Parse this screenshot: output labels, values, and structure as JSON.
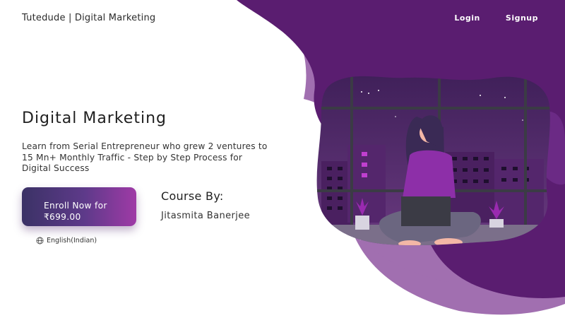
{
  "header": {
    "brand": "Tutedude | Digital Marketing",
    "nav": {
      "login": "Login",
      "signup": "Signup"
    }
  },
  "hero": {
    "title": "Digital Marketing",
    "description": "Learn from Serial Entrepreneur who grew 2 ventures to 15 Mn+ Monthly Traffic - Step by Step Process for Digital Success",
    "enroll": {
      "line1": "Enroll Now for",
      "line2": "₹699.00"
    },
    "language": "English(Indian)",
    "instructor_heading": "Course By:",
    "instructor_name": "Jitasmita Banerjee"
  },
  "colors": {
    "accent_dark": "#5a1d70",
    "accent_light": "#a16fb0",
    "button_start": "#3b3266",
    "button_end": "#9f3aa6"
  },
  "icons": {
    "language": "globe-icon"
  }
}
